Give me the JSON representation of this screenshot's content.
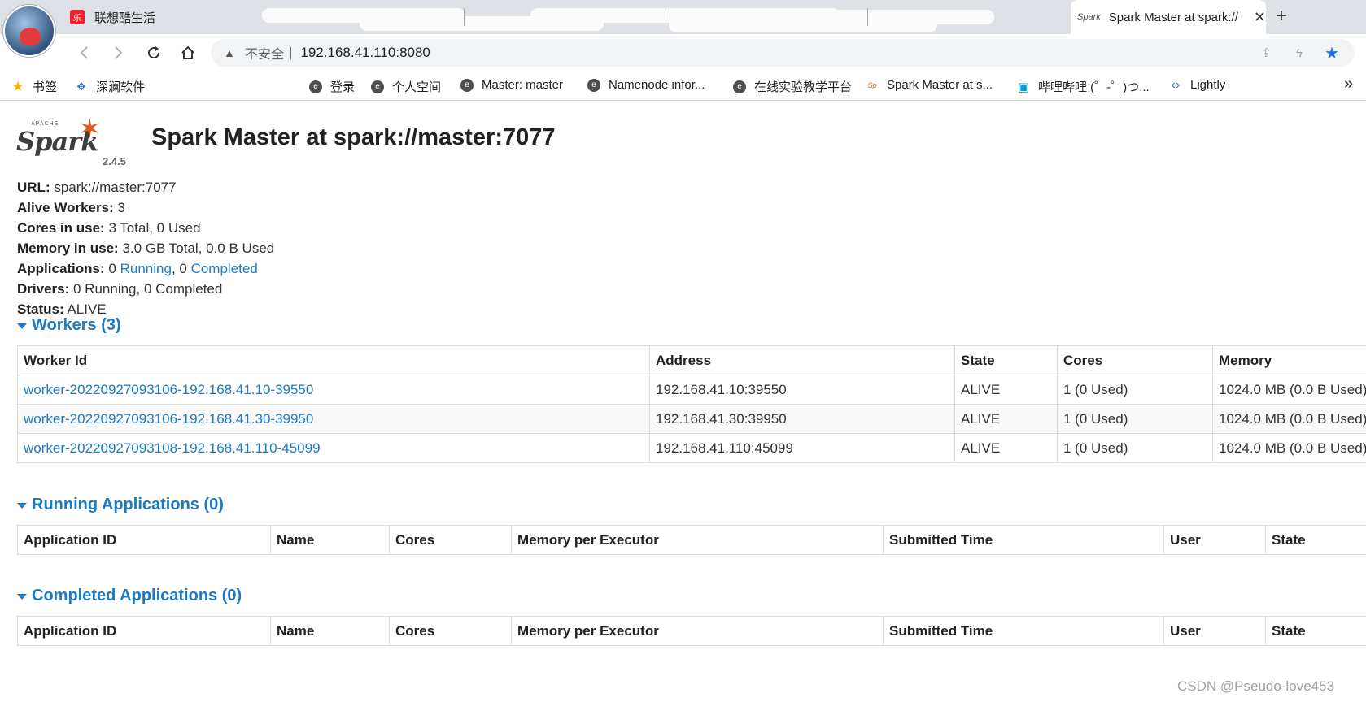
{
  "browser": {
    "tabs": [
      {
        "label": "联想酷生活"
      },
      {
        "label": "Spark Master at spark://"
      }
    ],
    "address": {
      "security_label": "不安全",
      "url": "192.168.41.110:8080"
    },
    "bookmarks": [
      {
        "label": "书签",
        "icon": "star-icon"
      },
      {
        "label": "深澜软件",
        "icon": "grid-icon"
      },
      {
        "label": "登录",
        "icon": "e-circle-icon"
      },
      {
        "label": "个人空间",
        "icon": "e-circle-icon"
      },
      {
        "label": "Master: master",
        "icon": "e-circle-icon"
      },
      {
        "label": "Namenode infor...",
        "icon": "e-circle-icon"
      },
      {
        "label": "在线实验教学平台",
        "icon": "e-circle-icon"
      },
      {
        "label": "Spark Master at s...",
        "icon": "spark-icon"
      },
      {
        "label": "哔哩哔哩 (゜-゜)つ...",
        "icon": "bilibili-icon"
      },
      {
        "label": "Lightly",
        "icon": "lightly-icon"
      }
    ],
    "more_label": "»"
  },
  "page": {
    "logo": {
      "apache": "APACHE",
      "word": "Spark",
      "version": "2.4.5"
    },
    "title": "Spark Master at spark://master:7077",
    "summary": {
      "url_label": "URL:",
      "url_value": "spark://master:7077",
      "workers_label": "Alive Workers:",
      "workers_value": "3",
      "cores_label": "Cores in use:",
      "cores_value": "3 Total, 0 Used",
      "memory_label": "Memory in use:",
      "memory_value": "3.0 GB Total, 0.0 B Used",
      "apps_label": "Applications:",
      "apps_running_count": "0",
      "apps_running_link": "Running",
      "apps_sep": ", 0",
      "apps_completed_link": "Completed",
      "drivers_label": "Drivers:",
      "drivers_value": "0 Running, 0 Completed",
      "status_label": "Status:",
      "status_value": "ALIVE"
    },
    "workers": {
      "heading": "Workers (3)",
      "columns": [
        "Worker Id",
        "Address",
        "State",
        "Cores",
        "Memory"
      ],
      "rows": [
        [
          "worker-20220927093106-192.168.41.10-39550",
          "192.168.41.10:39550",
          "ALIVE",
          "1 (0 Used)",
          "1024.0 MB (0.0 B Used)"
        ],
        [
          "worker-20220927093106-192.168.41.30-39950",
          "192.168.41.30:39950",
          "ALIVE",
          "1 (0 Used)",
          "1024.0 MB (0.0 B Used)"
        ],
        [
          "worker-20220927093108-192.168.41.110-45099",
          "192.168.41.110:45099",
          "ALIVE",
          "1 (0 Used)",
          "1024.0 MB (0.0 B Used)"
        ]
      ]
    },
    "running_apps": {
      "heading": "Running Applications (0)",
      "columns": [
        "Application ID",
        "Name",
        "Cores",
        "Memory per Executor",
        "Submitted Time",
        "User",
        "State"
      ]
    },
    "completed_apps": {
      "heading": "Completed Applications (0)",
      "columns": [
        "Application ID",
        "Name",
        "Cores",
        "Memory per Executor",
        "Submitted Time",
        "User",
        "State"
      ]
    }
  },
  "watermark": "CSDN @Pseudo-love453",
  "colors": {
    "link": "#1c7ac4",
    "spark_orange": "#e25a1c",
    "bookmark_star": "#f4b400",
    "omnibox_star": "#1a73e8"
  }
}
